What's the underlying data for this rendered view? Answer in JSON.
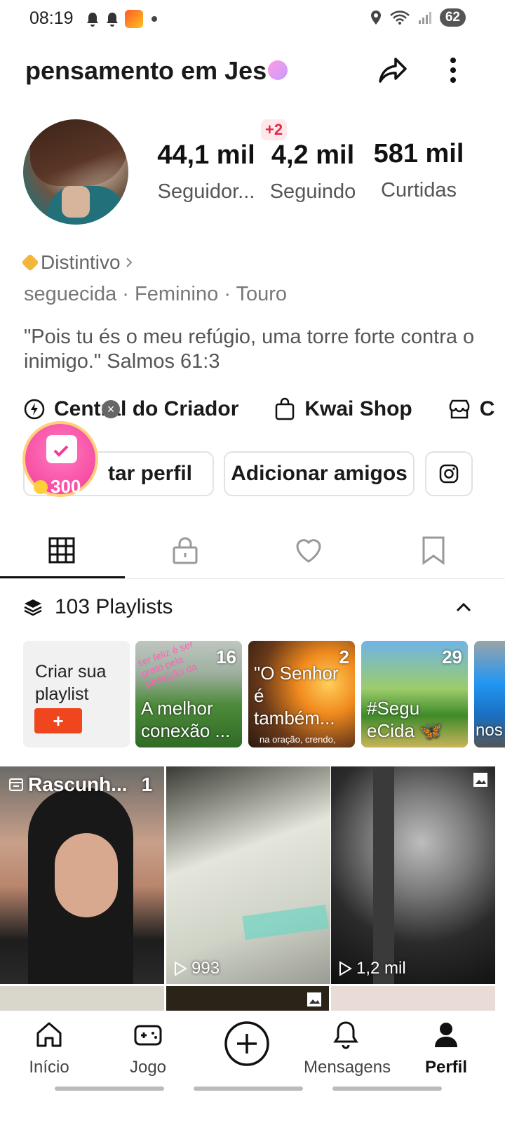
{
  "status_bar": {
    "time": "08:19",
    "battery": "62"
  },
  "header": {
    "username": "pensamento em Jes"
  },
  "profile": {
    "followers": {
      "value": "44,1 mil",
      "label": "Seguidor..."
    },
    "following": {
      "value": "4,2 mil",
      "label": "Seguindo",
      "delta": "+2"
    },
    "likes": {
      "value": "581 mil",
      "label": "Curtidas"
    },
    "badge_label": "Distintivo",
    "meta": "seguecida · Feminino · Touro",
    "bio": "\"Pois tu és o meu refúgio, uma torre forte contra o inimigo.\" Salmos 61:3"
  },
  "links": {
    "creator": "Central do Criador",
    "shop": "Kwai Shop",
    "more": "C"
  },
  "buttons": {
    "edit": "tar perfil",
    "add_friends": "Adicionar amigos"
  },
  "floating_badge": {
    "coins": "300"
  },
  "playlists": {
    "header": "103 Playlists",
    "create_label": "Criar sua playlist",
    "create_button": "+",
    "items": [
      {
        "count": "16",
        "title": "A melhor conexão ...",
        "overlay": "ser feliz é ser grato pela perfeição da"
      },
      {
        "count": "2",
        "title": "\"O Senhor é também...",
        "overlay": "na oração, crendo,"
      },
      {
        "count": "29",
        "title": "#Segu eCida 🦋"
      },
      {
        "count": "",
        "title": "nos #S nc"
      }
    ]
  },
  "grid": [
    {
      "label": "Rascunh...",
      "count": "1"
    },
    {
      "views": "993"
    },
    {
      "views": "1,2 mil"
    }
  ],
  "nav": {
    "home": "Início",
    "game": "Jogo",
    "messages": "Mensagens",
    "profile": "Perfil"
  }
}
